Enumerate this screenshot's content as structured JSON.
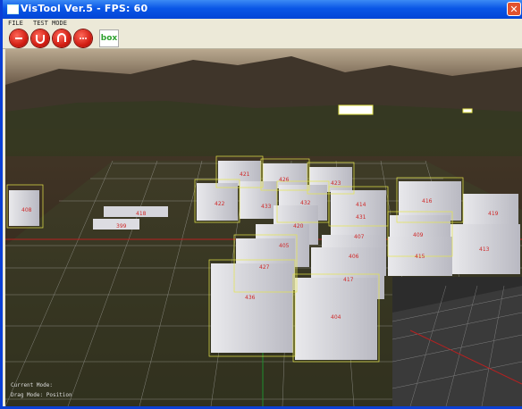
{
  "window": {
    "title": "VisTool Ver.5 - FPS: 60",
    "close_glyph": "✕"
  },
  "menu": {
    "items": [
      "FILE",
      "TEST MODE"
    ]
  },
  "toolbar": {
    "buttons": [
      {
        "name": "minus-icon"
      },
      {
        "name": "magnet-u-icon"
      },
      {
        "name": "arch-n-icon"
      },
      {
        "name": "ellipsis-icon"
      }
    ],
    "box_label": "box"
  },
  "scene": {
    "building_labels": [
      "436",
      "427",
      "404",
      "422",
      "421",
      "426",
      "423",
      "433",
      "399",
      "432",
      "414",
      "416",
      "419",
      "420",
      "407",
      "408",
      "409",
      "413",
      "418",
      "405",
      "406",
      "415",
      "417",
      "431"
    ],
    "status_line_1": "Current Mode:",
    "status_line_2": "Drag Mode: Position"
  },
  "colors": {
    "titlebar": "#0a56e6",
    "toolbar_button": "#d21e14",
    "grid": "#c8c8c8",
    "bbox": "#e6e64a",
    "label": "#d02a2a"
  }
}
